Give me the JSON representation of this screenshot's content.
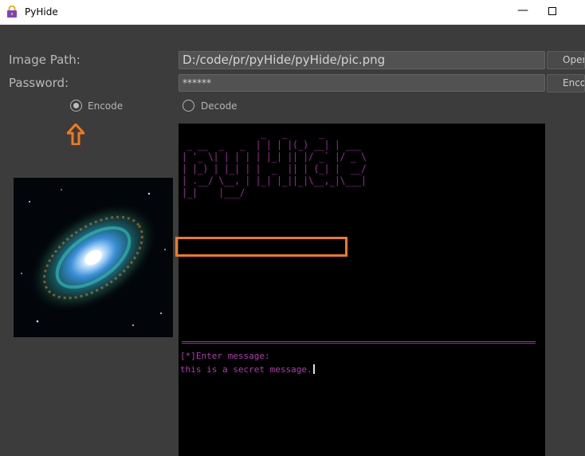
{
  "window": {
    "title": "PyHide",
    "minimize_glyph": "—"
  },
  "form": {
    "image_path_label": "Image Path:",
    "image_path_value": "D:/code/pr/pyHide/pyHide/pic.png",
    "password_label": "Password:",
    "password_value": "******",
    "open_button": "Open",
    "encode_button": "Encode",
    "mode_encode_label": "Encode",
    "mode_decode_label": "Decode",
    "selected_mode": "Encode"
  },
  "terminal": {
    "ascii_banner": "               _   _      _       \n _ __  _   _  | | | |(_) __| | ___ \n| '_ \\| | | | | |_| || |/ _` |/ _ \\\n| |_) | |_| | |  _  || | (_| |  __/\n| .__/ \\__, | |_| |_||_|\\__,_|\\___|\n|_|    |___/                      ",
    "prompt": "[*]Enter message:",
    "message": "this is a secret message."
  },
  "colors": {
    "background": "#3c3c3c",
    "terminal_text": "#b23cb2",
    "highlight": "#f27b1c"
  },
  "icons": {
    "app": "lock-icon",
    "annotation": "up-arrow-icon"
  }
}
